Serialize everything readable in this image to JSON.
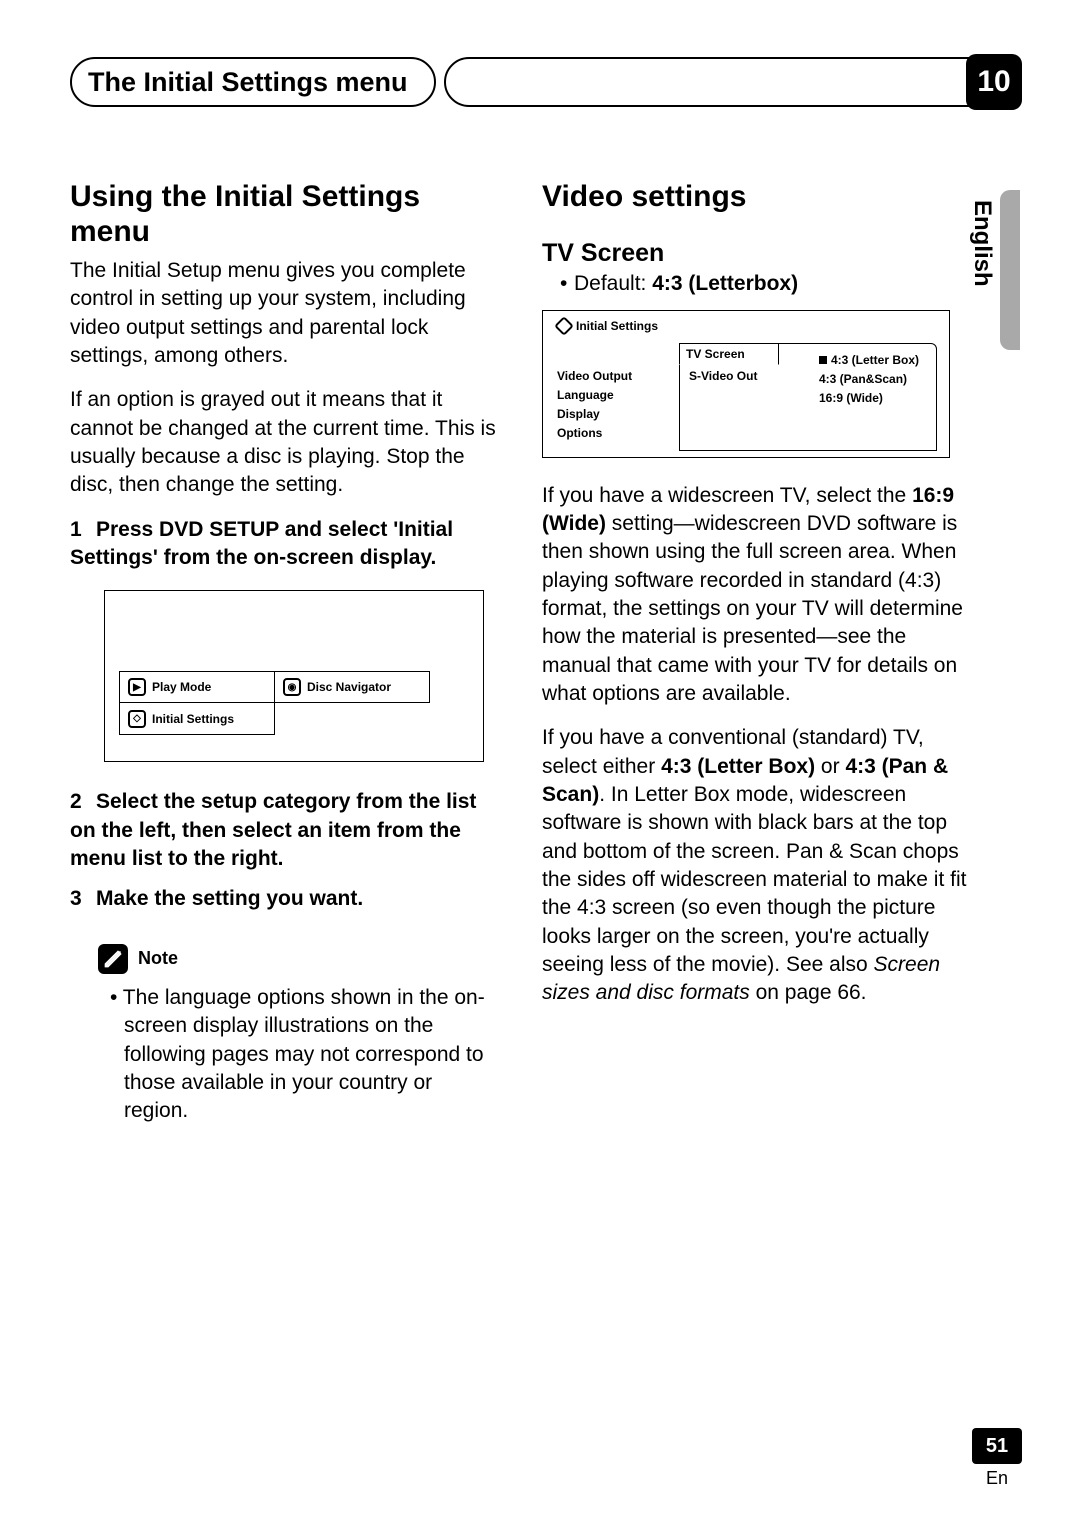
{
  "header": {
    "title": "The Initial Settings menu",
    "chapter": "10"
  },
  "side_language": "English",
  "left": {
    "h1": "Using the Initial Settings menu",
    "p1": "The Initial Setup menu gives you complete control in setting up your system, including video output settings and parental lock settings, among others.",
    "p2": "If an option is grayed out it means that it cannot be changed at the current time. This is usually because a disc is playing. Stop the disc, then change the setting.",
    "step1_num": "1",
    "step1": "Press DVD SETUP and select 'Initial Settings' from the on-screen display.",
    "osd1": {
      "play_mode": "Play Mode",
      "disc_nav": "Disc Navigator",
      "initial": "Initial Settings"
    },
    "step2_num": "2",
    "step2": "Select the setup category from the list on the left, then select an item from the menu list to the right.",
    "step3_num": "3",
    "step3": "Make the setting you want.",
    "note_label": "Note",
    "note_body": "• The language options shown in the on-screen display illustrations on the following pages may not correspond to those available in your country or region."
  },
  "right": {
    "h1": "Video settings",
    "h2": "TV Screen",
    "default_prefix": "Default: ",
    "default_value": "4:3 (Letterbox)",
    "osd2": {
      "title": "Initial Settings",
      "tab": "TV Screen",
      "left": [
        "Video Output",
        "Language",
        "Display",
        "Options"
      ],
      "mid": [
        "S-Video Out"
      ],
      "right": [
        "4:3 (Letter Box)",
        "4:3 (Pan&Scan)",
        "16:9 (Wide)"
      ]
    },
    "p1_a": "If you have a widescreen TV, select the ",
    "p1_b": "16:9 (Wide)",
    "p1_c": " setting—widescreen DVD software is then shown using the full screen area. When playing software recorded in standard (4:3) format, the settings on your TV will determine how the material is presented—see the manual that came with your TV for details on what options are available.",
    "p2_a": "If you have a conventional (standard) TV, select either ",
    "p2_b": "4:3 (Letter Box)",
    "p2_c": " or ",
    "p2_d": "4:3 (Pan & Scan)",
    "p2_e": ". In Letter Box mode, widescreen software is shown with black bars at the top and bottom of the screen. Pan & Scan chops the sides off widescreen material to make it fit the 4:3 screen (so even though the picture looks larger on the screen, you're actually seeing less of the movie). See also ",
    "p2_f": "Screen sizes and disc formats",
    "p2_g": " on page 66."
  },
  "footer": {
    "page": "51",
    "lang": "En"
  }
}
